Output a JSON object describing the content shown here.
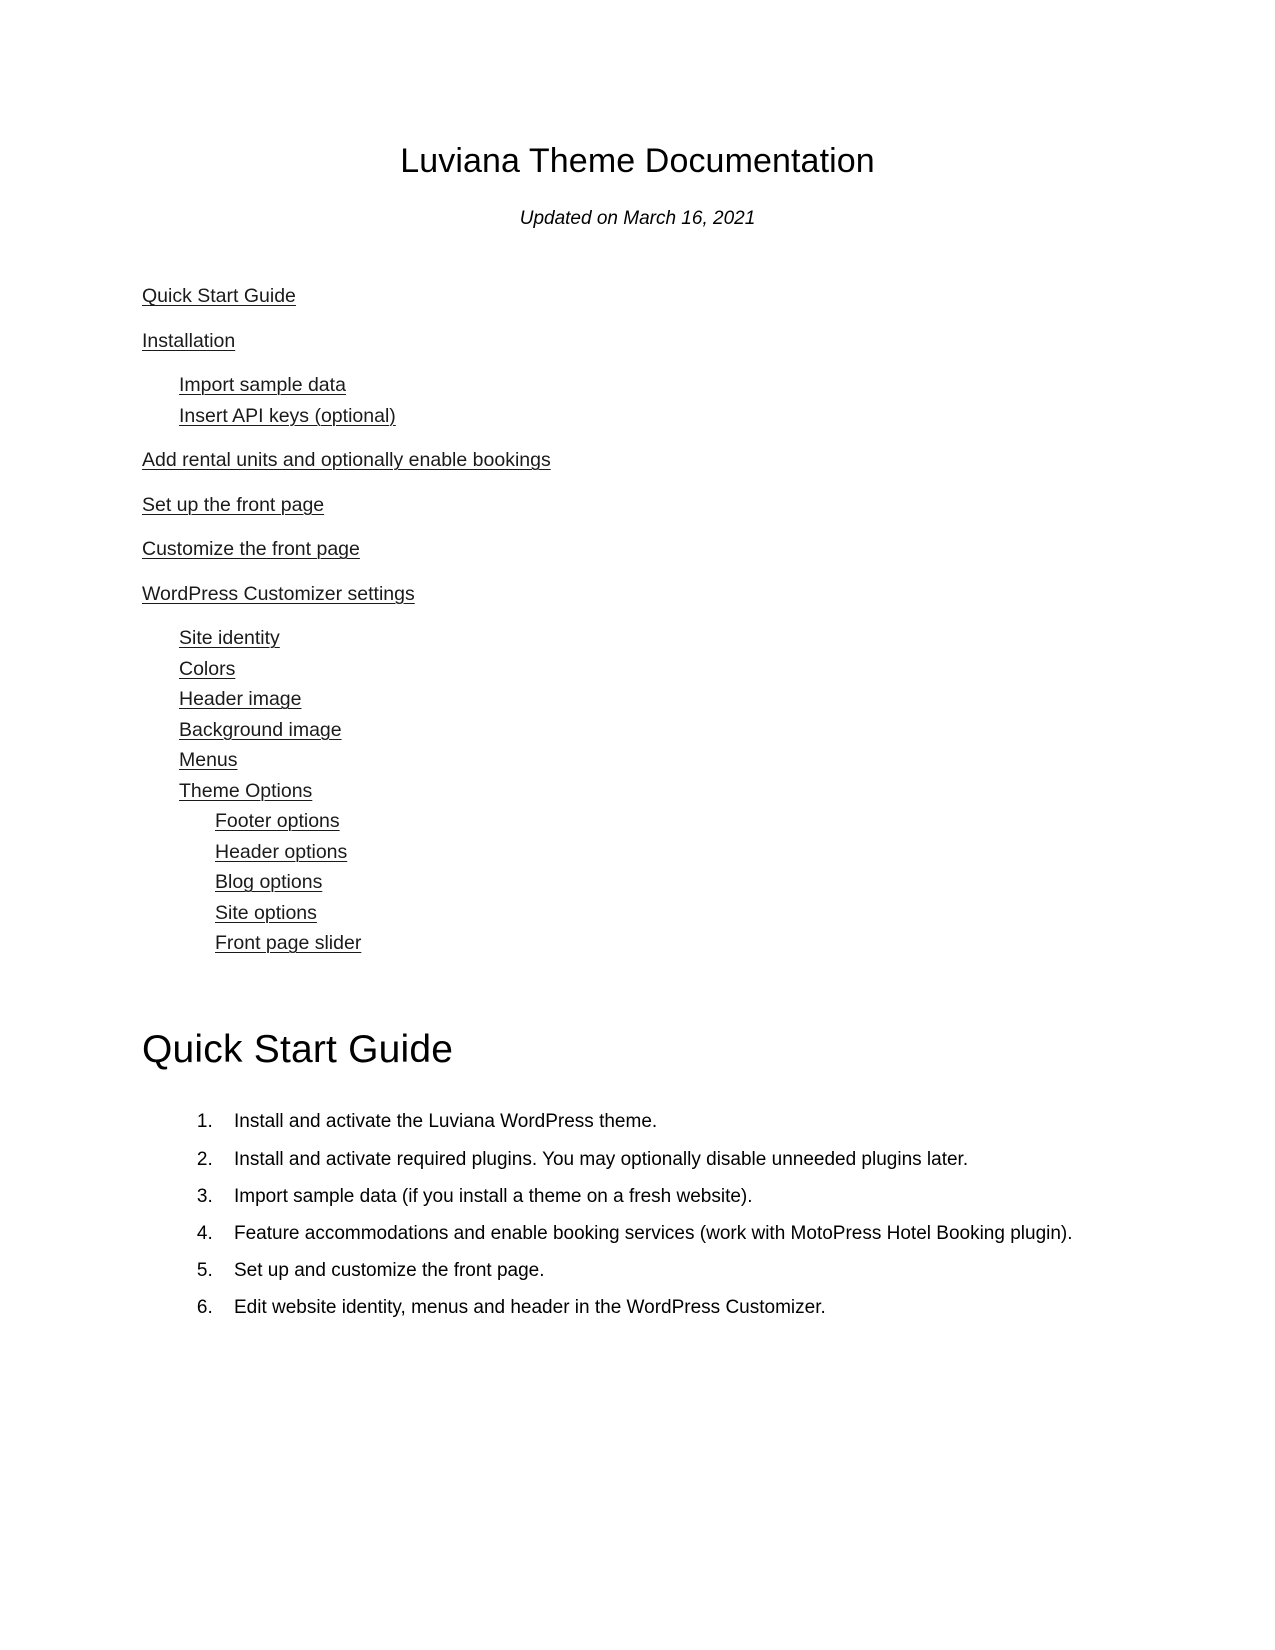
{
  "document": {
    "title": "Luviana Theme Documentation",
    "subtitle": "Updated on March 16, 2021"
  },
  "toc": {
    "items": [
      {
        "label": "Quick Start Guide",
        "level": 1
      },
      {
        "label": "Installation",
        "level": 1
      },
      {
        "label": "Import sample data",
        "level": 2
      },
      {
        "label": "Insert API keys (optional)",
        "level": 2
      },
      {
        "label": "Add rental units and optionally enable bookings",
        "level": 1
      },
      {
        "label": "Set up the front page",
        "level": 1
      },
      {
        "label": "Customize the front page",
        "level": 1
      },
      {
        "label": "WordPress Customizer settings",
        "level": 1
      },
      {
        "label": "Site identity",
        "level": 2
      },
      {
        "label": "Colors",
        "level": 2
      },
      {
        "label": "Header image",
        "level": 2
      },
      {
        "label": "Background image",
        "level": 2
      },
      {
        "label": "Menus",
        "level": 2
      },
      {
        "label": "Theme Options",
        "level": 2
      },
      {
        "label": "Footer options",
        "level": 3
      },
      {
        "label": "Header options",
        "level": 3
      },
      {
        "label": "Blog options",
        "level": 3
      },
      {
        "label": "Site options",
        "level": 3
      },
      {
        "label": "Front page slider",
        "level": 3
      }
    ]
  },
  "quick_start": {
    "heading": "Quick Start Guide",
    "steps": [
      "Install and activate the Luviana WordPress theme.",
      "Install and activate required plugins. You may optionally disable unneeded plugins later.",
      "Import sample data (if you install a theme on a fresh website).",
      "Feature accommodations and enable booking services (work with MotoPress Hotel Booking plugin).",
      "Set up and customize the front page.",
      "Edit website identity, menus and header in the WordPress Customizer."
    ]
  }
}
